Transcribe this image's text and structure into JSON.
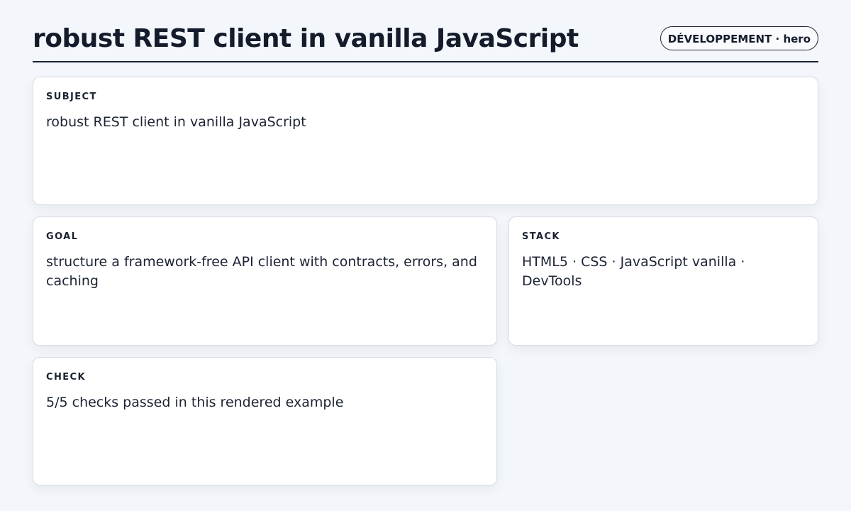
{
  "header": {
    "title": "robust REST client in vanilla JavaScript",
    "badge": "DÉVELOPPEMENT · hero"
  },
  "cards": {
    "subject": {
      "label": "SUBJECT",
      "text": "robust REST client in vanilla JavaScript"
    },
    "goal": {
      "label": "GOAL",
      "text": "structure a framework-free API client with contracts, errors, and caching"
    },
    "stack": {
      "label": "STACK",
      "text": "HTML5 · CSS · JavaScript vanilla · DevTools"
    },
    "check": {
      "label": "CHECK",
      "text": "5/5 checks passed in this rendered example"
    }
  }
}
